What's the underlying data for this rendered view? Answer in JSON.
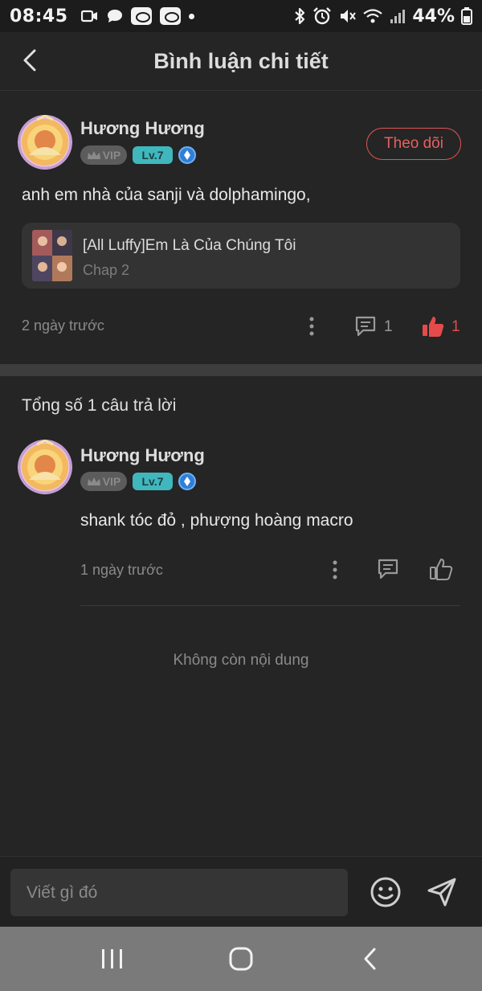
{
  "status_bar": {
    "time": "08:45",
    "battery": "44%",
    "icons": [
      "video-camera-icon",
      "chat-bubble-icon",
      "app-notification-icon",
      "app-notification-icon",
      "dot-icon",
      "bluetooth-icon",
      "alarm-icon",
      "mute-icon",
      "wifi-icon",
      "signal-icon",
      "battery-icon"
    ]
  },
  "header": {
    "title": "Bình luận chi tiết",
    "back_icon": "chevron-left-icon"
  },
  "main_comment": {
    "user_name": "Hương Hương",
    "vip_label": "VIP",
    "level": "Lv.7",
    "follow_label": "Theo dõi",
    "text": "anh em nhà của sanji và dolphamingo,",
    "chapter": {
      "title": "[All Luffy]Em Là Của Chúng Tôi",
      "subtitle": "Chap 2"
    },
    "time": "2 ngày trước",
    "reply_count": "1",
    "like_count": "1"
  },
  "replies": {
    "title": "Tổng số 1 câu trả lời",
    "items": [
      {
        "user_name": "Hương Hương",
        "vip_label": "VIP",
        "level": "Lv.7",
        "text": "shank tóc đỏ , phượng hoàng macro",
        "time": "1 ngày trước"
      }
    ],
    "end_text": "Không còn nội dung"
  },
  "composer": {
    "placeholder": "Viết gì đó"
  },
  "colors": {
    "background": "#252525",
    "accent_red": "#e54b4b",
    "level_badge": "#3fb7bd",
    "gem_badge": "#2f7fd8"
  }
}
